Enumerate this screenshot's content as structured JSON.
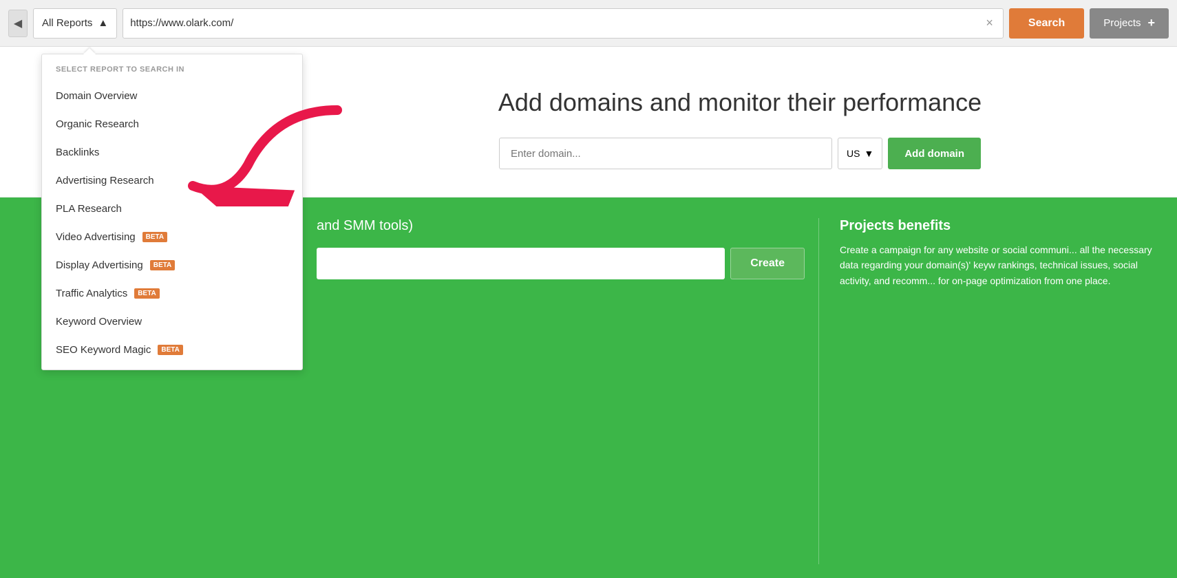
{
  "topbar": {
    "back_arrow": "◀",
    "report_selector_label": "All Reports",
    "report_selector_chevron": "▲",
    "url_value": "https://www.olark.com/",
    "clear_icon": "×",
    "search_label": "Search",
    "projects_label": "Projects",
    "projects_plus": "+"
  },
  "dropdown": {
    "header_label": "SELECT REPORT TO SEARCH IN",
    "items": [
      {
        "label": "Domain Overview",
        "badge": null
      },
      {
        "label": "Organic Research",
        "badge": null
      },
      {
        "label": "Backlinks",
        "badge": null
      },
      {
        "label": "Advertising Research",
        "badge": null
      },
      {
        "label": "PLA Research",
        "badge": null
      },
      {
        "label": "Video Advertising",
        "badge": "BETA"
      },
      {
        "label": "Display Advertising",
        "badge": "BETA"
      },
      {
        "label": "Traffic Analytics",
        "badge": "BETA"
      },
      {
        "label": "Keyword Overview",
        "badge": null
      },
      {
        "label": "SEO Keyword Magic",
        "badge": "BETA"
      }
    ]
  },
  "main": {
    "hero_title": "Add domains and monitor their performance",
    "domain_placeholder": "Enter domain...",
    "country_default": "US",
    "add_domain_label": "Add domain",
    "green_subtitle": "and SMM tools)",
    "create_label": "Create",
    "projects_benefits_title": "Projects benefits",
    "projects_benefits_text": "Create a campaign for any website or social communi... all the necessary data regarding your domain(s)' keyw rankings, technical issues, social activity, and recomm... for on-page optimization from one place."
  }
}
